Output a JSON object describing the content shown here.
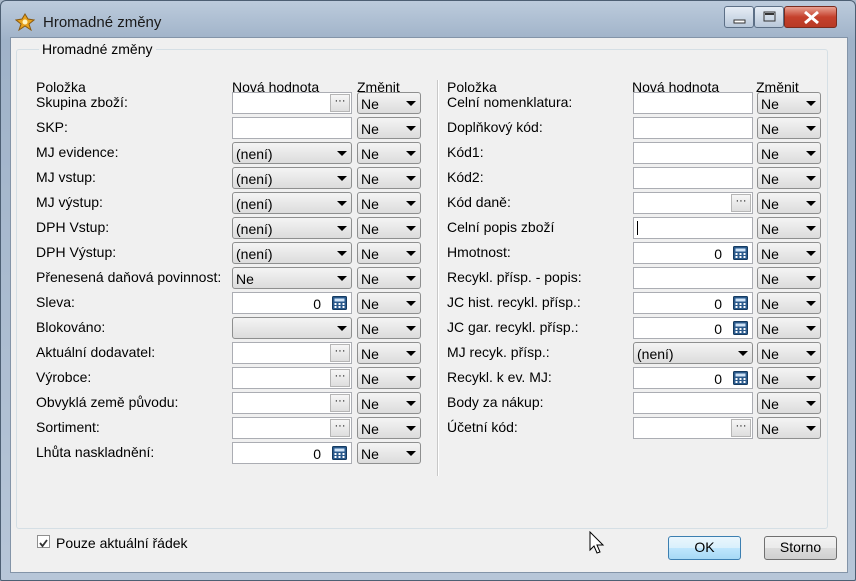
{
  "window": {
    "title": "Hromadné změny"
  },
  "group_title": "Hromadné změny",
  "columns": {
    "item": "Položka",
    "new_value": "Nová hodnota",
    "change": "Změnit"
  },
  "left_rows": [
    {
      "label": "Skupina zboží:",
      "type": "lookup",
      "value": "",
      "change": "Ne"
    },
    {
      "label": "SKP:",
      "type": "text",
      "value": "",
      "change": "Ne"
    },
    {
      "label": "MJ evidence:",
      "type": "combo",
      "value": "(není)",
      "change": "Ne"
    },
    {
      "label": "MJ vstup:",
      "type": "combo",
      "value": "(není)",
      "change": "Ne"
    },
    {
      "label": "MJ výstup:",
      "type": "combo",
      "value": "(není)",
      "change": "Ne"
    },
    {
      "label": "DPH Vstup:",
      "type": "combo",
      "value": "(není)",
      "change": "Ne"
    },
    {
      "label": "DPH Výstup:",
      "type": "combo",
      "value": "(není)",
      "change": "Ne"
    },
    {
      "label": "Přenesená daňová povinnost:",
      "type": "combo",
      "value": "Ne",
      "change": "Ne"
    },
    {
      "label": "Sleva:",
      "type": "number",
      "value": "0",
      "change": "Ne"
    },
    {
      "label": "Blokováno:",
      "type": "combo",
      "value": "",
      "change": "Ne"
    },
    {
      "label": "Aktuální dodavatel:",
      "type": "lookup",
      "value": "",
      "change": "Ne"
    },
    {
      "label": "Výrobce:",
      "type": "lookup",
      "value": "",
      "change": "Ne"
    },
    {
      "label": "Obvyklá země původu:",
      "type": "lookup",
      "value": "",
      "change": "Ne"
    },
    {
      "label": "Sortiment:",
      "type": "lookup",
      "value": "",
      "change": "Ne"
    },
    {
      "label": "Lhůta naskladnění:",
      "type": "number",
      "value": "0",
      "change": "Ne"
    }
  ],
  "right_rows": [
    {
      "label": "Celní nomenklatura:",
      "type": "text",
      "value": "",
      "change": "Ne"
    },
    {
      "label": "Doplňkový kód:",
      "type": "text",
      "value": "",
      "change": "Ne"
    },
    {
      "label": "Kód1:",
      "type": "text",
      "value": "",
      "change": "Ne"
    },
    {
      "label": "Kód2:",
      "type": "text",
      "value": "",
      "change": "Ne"
    },
    {
      "label": "Kód daně:",
      "type": "lookup",
      "value": "",
      "change": "Ne"
    },
    {
      "label": "Celní popis zboží",
      "type": "text-focused",
      "value": "",
      "change": "Ne"
    },
    {
      "label": "Hmotnost:",
      "type": "number",
      "value": "0",
      "change": "Ne"
    },
    {
      "label": "Recykl. přísp. - popis:",
      "type": "text",
      "value": "",
      "change": "Ne"
    },
    {
      "label": "JC hist. recykl. přísp.:",
      "type": "number",
      "value": "0",
      "change": "Ne"
    },
    {
      "label": "JC gar. recykl. přísp.:",
      "type": "number",
      "value": "0",
      "change": "Ne"
    },
    {
      "label": "MJ recyk. přísp.:",
      "type": "combo",
      "value": "(není)",
      "change": "Ne"
    },
    {
      "label": "Recykl. k ev. MJ:",
      "type": "number",
      "value": "0",
      "change": "Ne"
    },
    {
      "label": "Body za nákup:",
      "type": "text",
      "value": "",
      "change": "Ne"
    },
    {
      "label": "Účetní kód:",
      "type": "lookup",
      "value": "",
      "change": "Ne"
    }
  ],
  "lookup_button": "···",
  "only_current_row": {
    "label": "Pouze aktuální řádek",
    "checked": true
  },
  "buttons": {
    "ok": "OK",
    "cancel": "Storno"
  }
}
